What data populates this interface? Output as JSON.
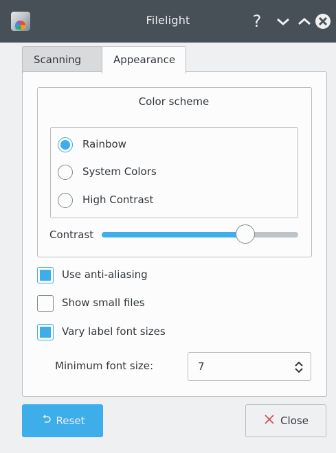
{
  "window": {
    "title": "Filelight",
    "help_symbol": "?"
  },
  "tabs": [
    {
      "label": "Scanning",
      "selected": false
    },
    {
      "label": "Appearance",
      "selected": true
    }
  ],
  "color_scheme": {
    "title": "Color scheme",
    "options": [
      {
        "label": "Rainbow",
        "checked": true
      },
      {
        "label": "System Colors",
        "checked": false
      },
      {
        "label": "High Contrast",
        "checked": false
      }
    ],
    "contrast_label": "Contrast",
    "contrast_value": 0.73
  },
  "options": {
    "anti_aliasing": {
      "label": "Use anti-aliasing",
      "checked": true
    },
    "show_small_files": {
      "label": "Show small files",
      "checked": false
    },
    "vary_label_font_sizes": {
      "label": "Vary label font sizes",
      "checked": true
    }
  },
  "minimum_font_size": {
    "label": "Minimum font size:",
    "value": "7"
  },
  "buttons": {
    "reset": "Reset",
    "close": "Close"
  },
  "icons": {
    "app": "filelight-icon",
    "help": "help-icon",
    "collapse": "chevron-down-icon",
    "expand": "chevron-up-icon",
    "close_window": "close-icon",
    "spinner": "up-down-icon",
    "reset": "undo-icon",
    "close_button": "x-icon"
  },
  "colors": {
    "accent": "#3daee9",
    "titlebar": "#475057",
    "close_icon": "#da4453"
  }
}
